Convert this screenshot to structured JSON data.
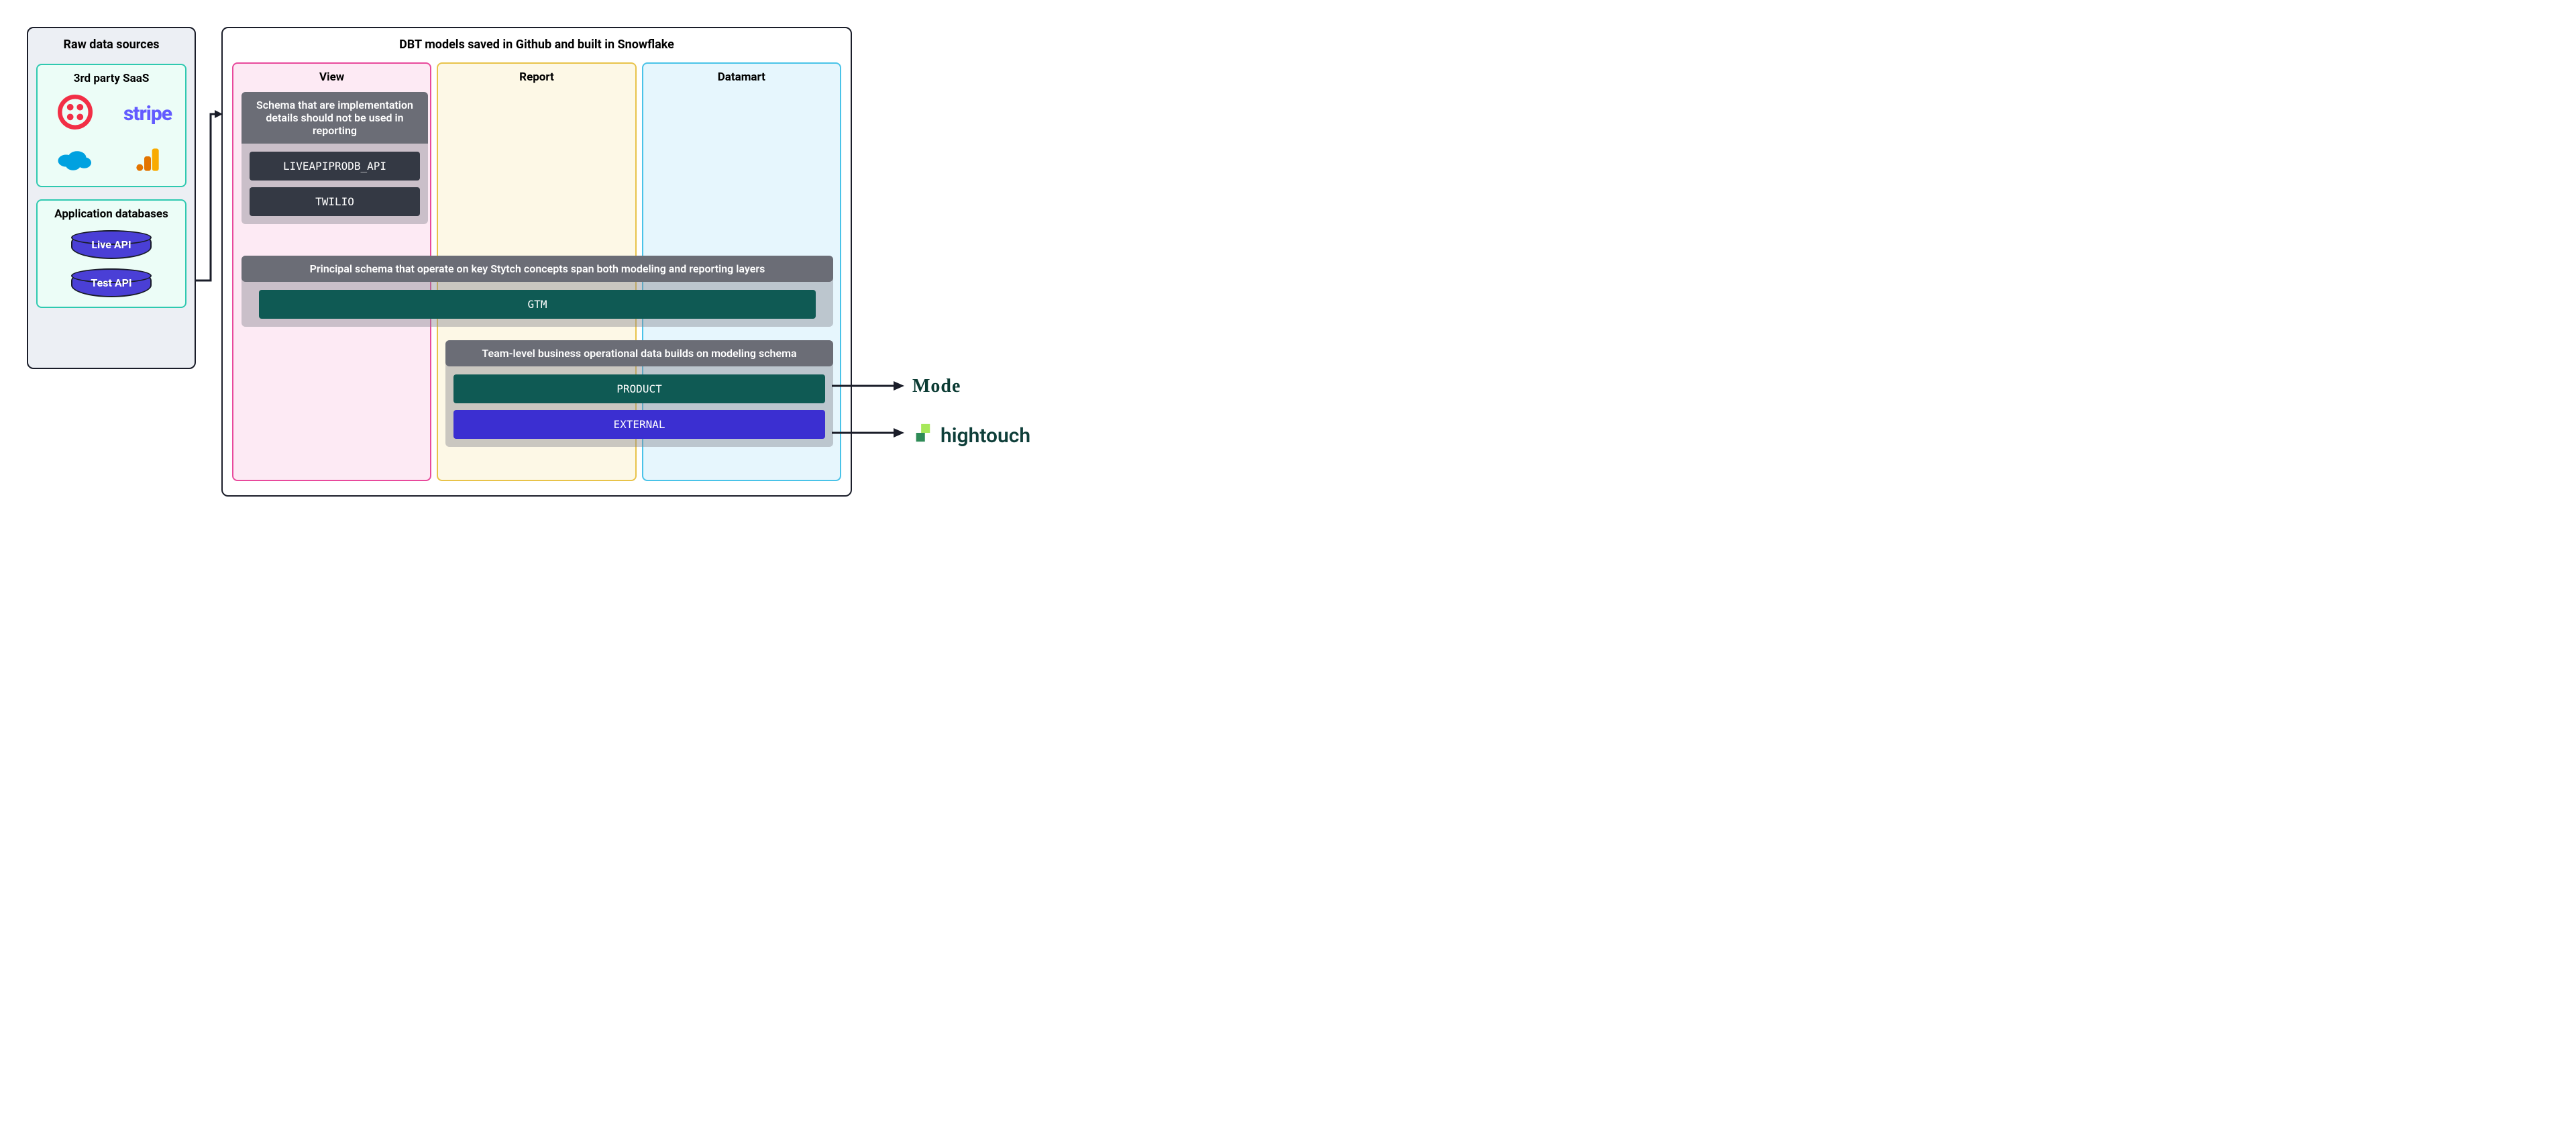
{
  "raw": {
    "title": "Raw data sources",
    "saas": {
      "title": "3rd party SaaS",
      "providers": [
        "twilio",
        "stripe",
        "salesforce",
        "google-analytics"
      ]
    },
    "appdb": {
      "title": "Application databases",
      "dbs": [
        "Live API",
        "Test API"
      ]
    }
  },
  "dbt": {
    "title": "DBT models saved in Github and built in Snowflake",
    "columns": {
      "view": "View",
      "report": "Report",
      "datamart": "Datamart"
    },
    "groups": {
      "impl": {
        "header": "Schema that are implementation details should not be used in reporting",
        "items": [
          "LIVEAPIPRODB_API",
          "TWILIO"
        ]
      },
      "principal": {
        "header": "Principal schema that operate on key Stytch concepts span both modeling and reporting layers",
        "items": [
          "GTM"
        ]
      },
      "team": {
        "header": "Team-level business operational data builds on modeling schema",
        "items": [
          "PRODUCT",
          "EXTERNAL"
        ]
      }
    }
  },
  "destinations": {
    "mode": "Mode",
    "hightouch": "hightouch"
  }
}
